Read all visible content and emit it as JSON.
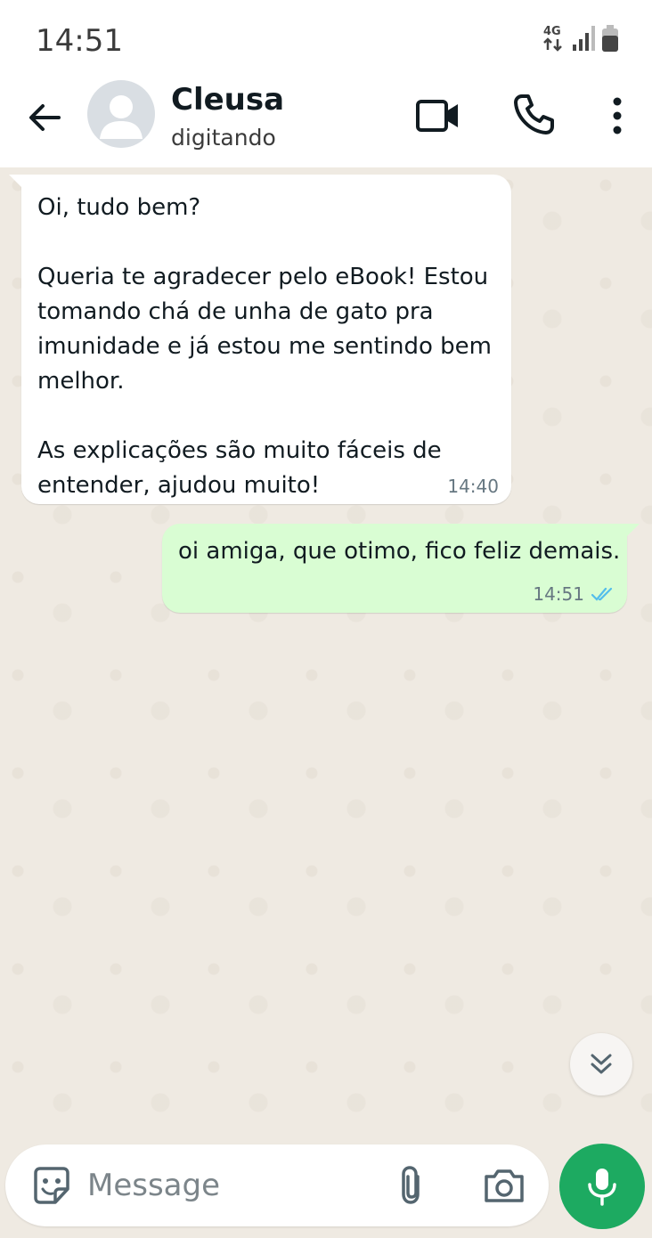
{
  "status_bar": {
    "time": "14:51",
    "network": "4G",
    "icons": [
      "network-4g-icon",
      "signal-icon",
      "battery-icon"
    ]
  },
  "header": {
    "contact_name": "Cleusa",
    "contact_status": "digitando",
    "icons": [
      "back-arrow-icon",
      "avatar-icon",
      "video-call-icon",
      "phone-call-icon",
      "more-vert-icon"
    ]
  },
  "messages": [
    {
      "direction": "incoming",
      "text": "Oi, tudo bem?\n\nQueria te agradecer pelo eBook! Estou tomando chá de unha de gato pra imunidade e já estou me sentindo bem melhor.\n\nAs explicações são muito fáceis de entender, ajudou muito!",
      "time": "14:40"
    },
    {
      "direction": "outgoing",
      "text": "oi amiga, que otimo, fico feliz demais.",
      "time": "14:51",
      "status_icon": "double-check-read-icon"
    }
  ],
  "composer": {
    "placeholder": "Message",
    "icons": [
      "sticker-icon",
      "paperclip-icon",
      "camera-icon",
      "mic-icon"
    ]
  },
  "colors": {
    "chat_background": "#efeae2",
    "incoming_bubble": "#ffffff",
    "outgoing_bubble": "#d9fdd3",
    "accent_green": "#1daa61",
    "read_ticks": "#53bdeb"
  }
}
